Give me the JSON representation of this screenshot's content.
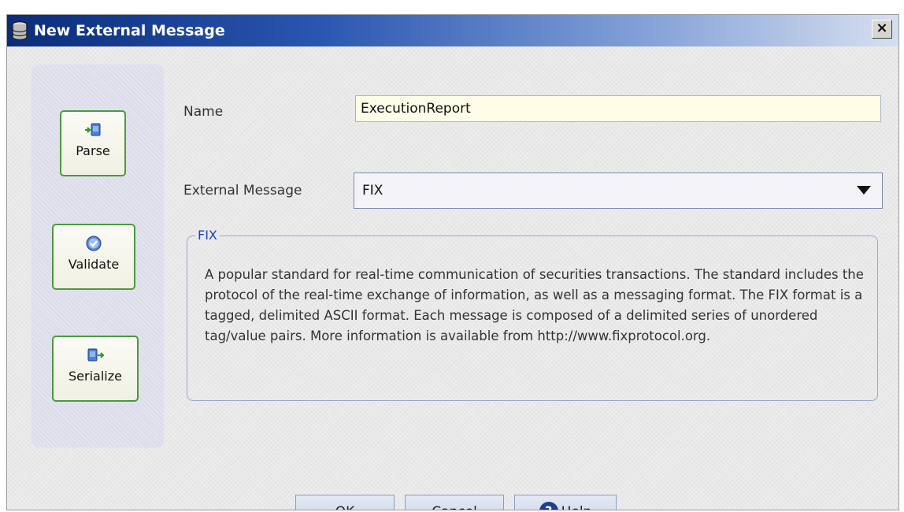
{
  "window": {
    "title": "New External Message",
    "close_label": "×"
  },
  "sidebar": {
    "items": [
      {
        "label": "Parse",
        "icon": "parse-icon"
      },
      {
        "label": "Validate",
        "icon": "validate-icon"
      },
      {
        "label": "Serialize",
        "icon": "serialize-icon"
      }
    ]
  },
  "form": {
    "name_label": "Name",
    "name_value": "ExecutionReport",
    "external_label": "External Message",
    "external_value": "FIX"
  },
  "info": {
    "title": "FIX",
    "description": "A popular standard for real-time communication of securities transactions. The standard includes the protocol of the real-time exchange of information, as well as a messaging format. The FIX format is a tagged, delimited ASCII format. Each message is composed of a delimited series of unordered tag/value pairs. More information is available from http://www.fixprotocol.org."
  },
  "buttons": {
    "ok": "OK",
    "cancel": "Cancel",
    "help": "Help",
    "help_glyph": "?"
  },
  "colors": {
    "title_gradient_start": "#0a2c7a",
    "button_border_green": "#4a9a3e",
    "legend_blue": "#1a44c0",
    "input_background": "#fdfde8"
  }
}
